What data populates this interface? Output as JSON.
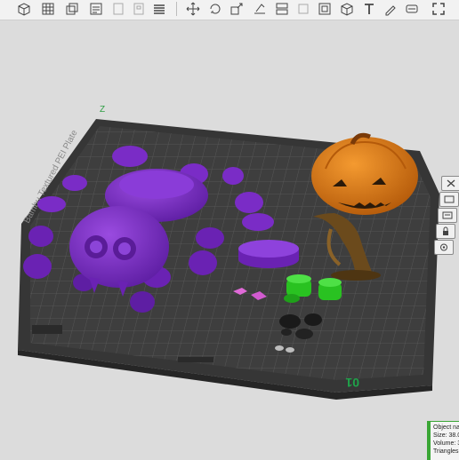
{
  "toolbar": {
    "left_icons": [
      "add-object-icon",
      "grid-icon",
      "copy-icon",
      "list-icon",
      "page-icon",
      "plate-icon",
      "menu-icon"
    ],
    "right_icons": [
      "move-icon",
      "rotate-icon",
      "scale-icon",
      "place-on-face-icon",
      "split-icon",
      "cut-icon",
      "box-icon",
      "cube-icon",
      "text-icon",
      "paint-icon",
      "seam-icon",
      "fullscreen-icon"
    ]
  },
  "plate": {
    "name": "Bambu Textured PEI Plate",
    "axis_y_label": "Z",
    "plate_number": "01"
  },
  "side_buttons": [
    "close-icon",
    "orient-icon",
    "arrange-icon",
    "lock-icon",
    "settings-icon"
  ],
  "object_info": {
    "name_line": "Object na",
    "size_line": "Size: 38.0",
    "volume_line": "Volume: 3",
    "triangles_line": "Triangles:"
  },
  "colors": {
    "plate": "#3b3b3b",
    "spider": "#7d2fc9",
    "pumpkin": "#e07b16",
    "stand": "#6b4a1c",
    "green": "#29c221",
    "pink": "#e06ad8",
    "accent": "#3aa635"
  }
}
